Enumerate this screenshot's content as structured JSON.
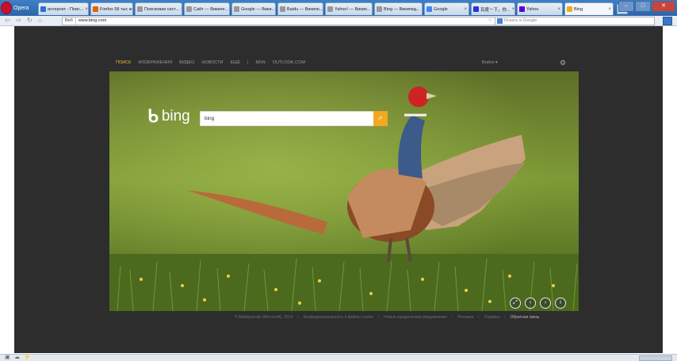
{
  "browser": {
    "app_label": "Opera",
    "tabs": [
      {
        "label": "интернет - Поис...",
        "favicon_color": "#2b6fd6"
      },
      {
        "label": "Firefox 58 тыс ко...",
        "favicon_color": "#e66000"
      },
      {
        "label": "Поисковая сист...",
        "favicon_color": "#999999"
      },
      {
        "label": "Сайт — Википе...",
        "favicon_color": "#999999"
      },
      {
        "label": "Google — Вики...",
        "favicon_color": "#999999"
      },
      {
        "label": "Baidu — Википе...",
        "favicon_color": "#999999"
      },
      {
        "label": "Yahoo! — Викип...",
        "favicon_color": "#999999"
      },
      {
        "label": "Bing — Википед...",
        "favicon_color": "#999999"
      },
      {
        "label": "Google",
        "favicon_color": "#4285f4"
      },
      {
        "label": "百度一下，你...",
        "favicon_color": "#2932e1"
      },
      {
        "label": "Yahoo",
        "favicon_color": "#6001d2"
      },
      {
        "label": "Bing",
        "favicon_color": "#f0a921"
      }
    ],
    "new_tab_label": "+",
    "address_badge": "Веб",
    "address_url": "www.bing.com",
    "search_placeholder": "Искать в Google"
  },
  "bing": {
    "nav": [
      "ПОИСК",
      "ИЗОБРАЖЕНИЯ",
      "ВИДЕО",
      "НОВОСТИ",
      "ЕЩЁ",
      "|",
      "MSN",
      "OUTLOOK.COM"
    ],
    "signin": "Войти",
    "logo_text": "bing",
    "query": "bing",
    "footer": [
      "© Майкрософт (Microsoft), 2014",
      "Конфиденциальность и файлы cookie",
      "Новые юридические уведомления",
      "Реклама",
      "Справка",
      "Обратная связь"
    ],
    "accent": "#f0a921"
  }
}
